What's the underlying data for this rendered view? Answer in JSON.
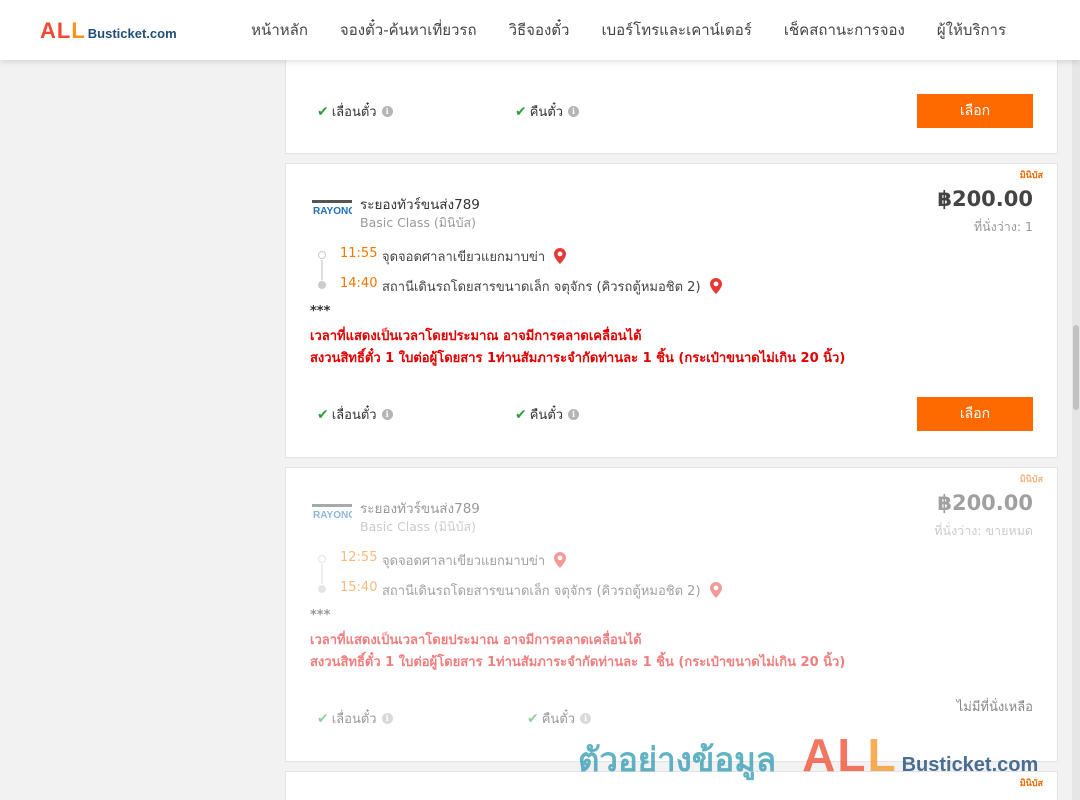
{
  "header": {
    "logo_all": "ALL",
    "logo_rest": "Busticket.com",
    "nav": [
      "หน้าหลัก",
      "จองตั๋ว-ค้นหาเที่ยวรถ",
      "วิธีจองตั๋ว",
      "เบอร์โทรและเคาน์เตอร์",
      "เช็คสถานะการจอง",
      "ผู้ให้บริการ"
    ]
  },
  "cards": [
    {
      "features": {
        "change": "เลื่อนตั๋ว",
        "refund": "คืนตั๋ว"
      },
      "select_label": "เลือก"
    },
    {
      "badge": "มินิบัส",
      "operator": "ระยองทัวร์ขนส่ง789",
      "operator_logo": "RAYONG",
      "class": "Basic Class (มินิบัส)",
      "price": "฿200.00",
      "seats": "ที่นั่งว่าง: 1",
      "depart_time": "11:55",
      "depart_place": "จุดจอดศาลาเขียวแยกมาบข่า",
      "arrive_time": "14:40",
      "arrive_place": "สถานีเดินรถโดยสารขนาดเล็ก จตุจักร (คิวรถตู้หมอชิต 2)",
      "stars": "***",
      "notice1": "เวลาที่แสดงเป็นเวลาโดยประมาณ อาจมีการคลาดเคลื่อนได้",
      "notice2": "สงวนสิทธิ์ตั๋ว 1 ใบต่อผู้โดยสาร 1ท่านสัมภาระจำกัดท่านละ 1 ชิ้น (กระเป๋าขนาดไม่เกิน 20 นิ้ว)",
      "features": {
        "change": "เลื่อนตั๋ว",
        "refund": "คืนตั๋ว"
      },
      "select_label": "เลือก"
    },
    {
      "badge": "มินิบัส",
      "operator": "ระยองทัวร์ขนส่ง789",
      "operator_logo": "RAYONG",
      "class": "Basic Class (มินิบัส)",
      "price": "฿200.00",
      "seats": "ที่นั่งว่าง: ขายหมด",
      "depart_time": "12:55",
      "depart_place": "จุดจอดศาลาเขียวแยกมาบข่า",
      "arrive_time": "15:40",
      "arrive_place": "สถานีเดินรถโดยสารขนาดเล็ก จตุจักร (คิวรถตู้หมอชิต 2)",
      "stars": "***",
      "notice1": "เวลาที่แสดงเป็นเวลาโดยประมาณ อาจมีการคลาดเคลื่อนได้",
      "notice2": "สงวนสิทธิ์ตั๋ว 1 ใบต่อผู้โดยสาร 1ท่านสัมภาระจำกัดท่านละ 1 ชิ้น (กระเป๋าขนาดไม่เกิน 20 นิ้ว)",
      "features": {
        "change": "เลื่อนตั๋ว",
        "refund": "คืนตั๋ว"
      },
      "sold_out_text": "ไม่มีที่นั่งเหลือ"
    },
    {
      "badge": "มินิบัส"
    }
  ],
  "watermark": {
    "thai": "ตัวอย่างข้อมูล",
    "all": "ALL",
    "rest": "Busticket.com"
  },
  "colors": {
    "accent": "#ff6a00",
    "time": "#f07800",
    "notice": "#e00000",
    "check": "#2e9e3f",
    "pin": "#e53935"
  }
}
